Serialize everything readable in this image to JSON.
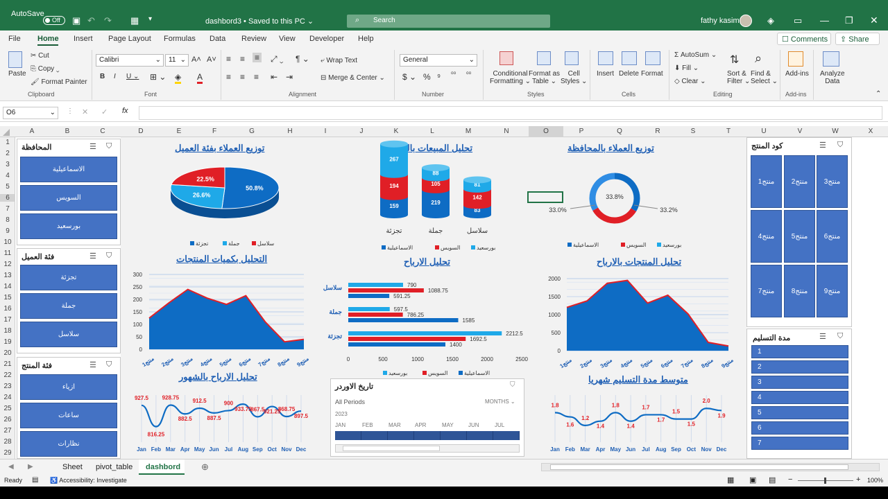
{
  "window": {
    "autosave": "AutoSave",
    "toggle": "Off",
    "doc": "dashbord3 • Saved to this PC ⌄",
    "search": "Search",
    "user": "fathy kasim"
  },
  "menu": [
    "File",
    "Home",
    "Insert",
    "Page Layout",
    "Formulas",
    "Data",
    "Review",
    "View",
    "Developer",
    "Help"
  ],
  "menu_right": {
    "comments": "Comments",
    "share": "Share"
  },
  "ribbon": {
    "paste": "Paste",
    "cut": "Cut",
    "copy": "Copy",
    "format_painter": "Format Painter",
    "clipboard": "Clipboard",
    "font_name": "Calibri",
    "font_size": "11",
    "font": "Font",
    "wrap": "Wrap Text",
    "merge": "Merge & Center",
    "alignment": "Alignment",
    "numfmt": "General",
    "number": "Number",
    "cond": "Conditional",
    "cond2": "Formatting",
    "fmt_table": "Format as",
    "fmt_table2": "Table",
    "cell_styles": "Cell",
    "cell_styles2": "Styles",
    "styles": "Styles",
    "insert": "Insert",
    "delete": "Delete",
    "format": "Format",
    "cells": "Cells",
    "autosum": "AutoSum",
    "fill": "Fill",
    "clear": "Clear",
    "sort": "Sort &",
    "sort2": "Filter",
    "find": "Find &",
    "find2": "Select",
    "editing": "Editing",
    "addins": "Add-ins",
    "addins_grp": "Add-ins",
    "analyze": "Analyze",
    "analyze2": "Data"
  },
  "formula_bar": {
    "cellref": "O6",
    "value": ""
  },
  "columns": [
    "A",
    "B",
    "C",
    "D",
    "E",
    "F",
    "G",
    "H",
    "I",
    "J",
    "K",
    "L",
    "M",
    "N",
    "O",
    "P",
    "Q",
    "R",
    "S",
    "T",
    "U",
    "V",
    "W",
    "X"
  ],
  "rows": [
    "1",
    "2",
    "3",
    "4",
    "5",
    "6",
    "7",
    "8",
    "9",
    "10",
    "11",
    "12",
    "13",
    "14",
    "15",
    "16",
    "17",
    "18",
    "19",
    "20",
    "21",
    "22",
    "23",
    "24",
    "25",
    "26",
    "27",
    "28",
    "29"
  ],
  "slicers": {
    "gov": {
      "title": "المحافظة",
      "items": [
        "الاسماعيلية",
        "السويس",
        "بورسعيد"
      ]
    },
    "cust": {
      "title": "فئة العميل",
      "items": [
        "تجزئة",
        "جملة",
        "سلاسل"
      ]
    },
    "prod": {
      "title": "فئة المنتج",
      "items": [
        "ازياء",
        "ساعات",
        "نظارات"
      ]
    },
    "code": {
      "title": "كود المنتج",
      "items": [
        "منتج1",
        "منتج2",
        "منتج3",
        "منتج4",
        "منتج5",
        "منتج6",
        "منتج7",
        "منتج8",
        "منتج9"
      ]
    },
    "delivery": {
      "title": "مدة التسليم",
      "items": [
        "1",
        "2",
        "3",
        "4",
        "5",
        "6",
        "7"
      ]
    }
  },
  "timeline": {
    "title": "تاريخ الاوردر",
    "period": "All Periods",
    "unit": "MONTHS",
    "year": "2023",
    "months": [
      "JAN",
      "FEB",
      "MAR",
      "APR",
      "MAY",
      "JUN",
      "JUL"
    ]
  },
  "sheet_tabs": [
    "Sheet",
    "pivot_table",
    "dashbord"
  ],
  "status": {
    "ready": "Ready",
    "access": "Accessibility: Investigate",
    "zoom": "100%"
  },
  "colors": {
    "blue": "#0e6cc4",
    "red": "#e01f26",
    "light": "#1fa9e8",
    "slicer": "#4472c4"
  },
  "chart_data": [
    {
      "type": "pie",
      "title": "توزيع العملاء بفئة العميل",
      "categories": [
        "تجزئة",
        "جملة",
        "سلاسل"
      ],
      "values": [
        50.8,
        26.6,
        22.5
      ],
      "labels": [
        "50.8%",
        "26.6%",
        "22.5%"
      ],
      "legend": "bottom"
    },
    {
      "type": "bar",
      "title": "تحليل المبيعات بالكميات",
      "categories": [
        "تجزئة",
        "جملة",
        "سلاسل"
      ],
      "series": [
        {
          "name": "الاسماعيلية",
          "values": [
            159,
            219,
            83
          ]
        },
        {
          "name": "السويس",
          "values": [
            194,
            105,
            142
          ]
        },
        {
          "name": "بورسعيد",
          "values": [
            267,
            88,
            81
          ]
        }
      ],
      "legend": "bottom"
    },
    {
      "type": "pie",
      "title": "توزيع العملاء بالمحافظة",
      "categories": [
        "الاسماعيلية",
        "السويس",
        "بورسعيد"
      ],
      "values": [
        33.8,
        33.0,
        33.2
      ],
      "labels": [
        "33.8%",
        "33.0%",
        "33.2%"
      ],
      "legend": "bottom"
    },
    {
      "type": "area",
      "title": "التحليل بكميات المنتجات",
      "categories": [
        "منتج1",
        "منتج2",
        "منتج3",
        "منتج4",
        "منتج5",
        "منتج6",
        "منتج7",
        "منتج8",
        "منتج9"
      ],
      "values": [
        125,
        185,
        240,
        205,
        180,
        215,
        110,
        30,
        40
      ],
      "ylim": [
        0,
        300
      ],
      "yticks": [
        0,
        50,
        100,
        150,
        200,
        250,
        300
      ]
    },
    {
      "type": "bar",
      "title": "تحليل الارباح",
      "categories": [
        "سلاسل",
        "جملة",
        "تجزئة"
      ],
      "series": [
        {
          "name": "بورسعيد",
          "values": [
            790,
            597.5,
            2212.5
          ]
        },
        {
          "name": "السويس",
          "values": [
            1088.75,
            786.25,
            1692.5
          ]
        },
        {
          "name": "الاسماعيلية",
          "values": [
            591.25,
            1585,
            1400
          ]
        }
      ],
      "xlim": [
        0,
        2500
      ],
      "xticks": [
        0,
        500,
        1000,
        1500,
        2000,
        2500
      ],
      "legend": "bottom"
    },
    {
      "type": "area",
      "title": "تحليل المنتجات بالارباح",
      "categories": [
        "منتج1",
        "منتج2",
        "منتج3",
        "منتج4",
        "منتج5",
        "منتج6",
        "منتج7",
        "منتج8",
        "منتج9"
      ],
      "values": [
        1200,
        1380,
        1870,
        1950,
        1320,
        1540,
        1020,
        230,
        130
      ],
      "ylim": [
        0,
        2000
      ],
      "yticks": [
        0,
        500,
        1000,
        1500,
        2000
      ]
    },
    {
      "type": "line",
      "title": "تحليل الارباح بالشهور",
      "categories": [
        "Jan",
        "Feb",
        "Mar",
        "Apr",
        "May",
        "Jun",
        "Jul",
        "Aug",
        "Sep",
        "Oct",
        "Nov",
        "Dec"
      ],
      "values": [
        927.5,
        816.25,
        928.75,
        882.5,
        912.5,
        887.5,
        900,
        933.75,
        867.5,
        921.25,
        868.75,
        897.5
      ],
      "labels": [
        "927.5",
        "816.25",
        "928.75",
        "882.5",
        "912.5",
        "887.5",
        "900",
        "933.75",
        "867.5",
        "921.25",
        "868.75",
        "897.5"
      ]
    },
    {
      "type": "line",
      "title": "متوسط مدة التسليم شهريا",
      "categories": [
        "Jan",
        "Feb",
        "Mar",
        "Apr",
        "May",
        "Jun",
        "Jul",
        "Aug",
        "Sep",
        "Oct",
        "Nov",
        "Dec"
      ],
      "values": [
        1.8,
        1.6,
        1.2,
        1.4,
        1.8,
        1.4,
        1.7,
        1.7,
        1.5,
        1.5,
        2.0,
        1.9
      ],
      "labels": [
        "1.8",
        "1.6",
        "1.2",
        "1.4",
        "1.8",
        "1.4",
        "1.7",
        "1.7",
        "1.5",
        "1.5",
        "2.0",
        "1.9"
      ]
    }
  ]
}
